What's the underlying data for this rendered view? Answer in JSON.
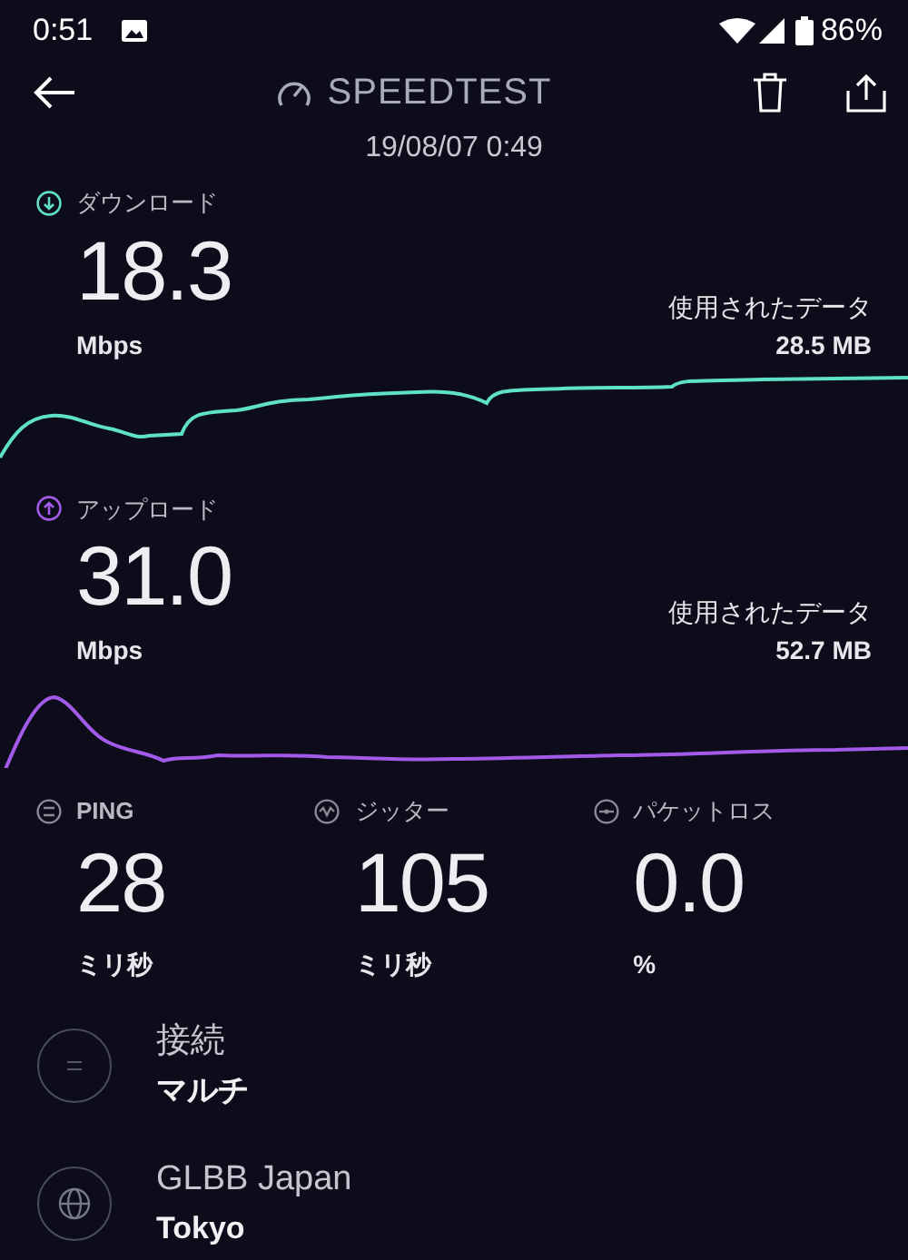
{
  "status_bar": {
    "time": "0:51",
    "battery": "86%"
  },
  "toolbar": {
    "title": "SPEEDTEST",
    "date": "19/08/07 0:49"
  },
  "results": [
    {
      "kind": "download",
      "label": "ダウンロード",
      "value": "18.3",
      "unit": "Mbps",
      "data_label": "使用されたデータ",
      "data_value": "28.5 MB"
    },
    {
      "kind": "upload",
      "label": "アップロード",
      "value": "31.0",
      "unit": "Mbps",
      "data_label": "使用されたデータ",
      "data_value": "52.7 MB"
    }
  ],
  "metrics": [
    {
      "kind": "ping",
      "label": "PING",
      "value": "28",
      "unit": "ミリ秒"
    },
    {
      "kind": "jitter",
      "label": "ジッター",
      "value": "105",
      "unit": "ミリ秒"
    },
    {
      "kind": "loss",
      "label": "パケットロス",
      "value": "0.0",
      "unit": "%"
    }
  ],
  "details": [
    {
      "kind": "connection",
      "title": "接続",
      "value": "マルチ"
    },
    {
      "kind": "server",
      "title": "GLBB Japan",
      "value": "Tokyo"
    }
  ]
}
